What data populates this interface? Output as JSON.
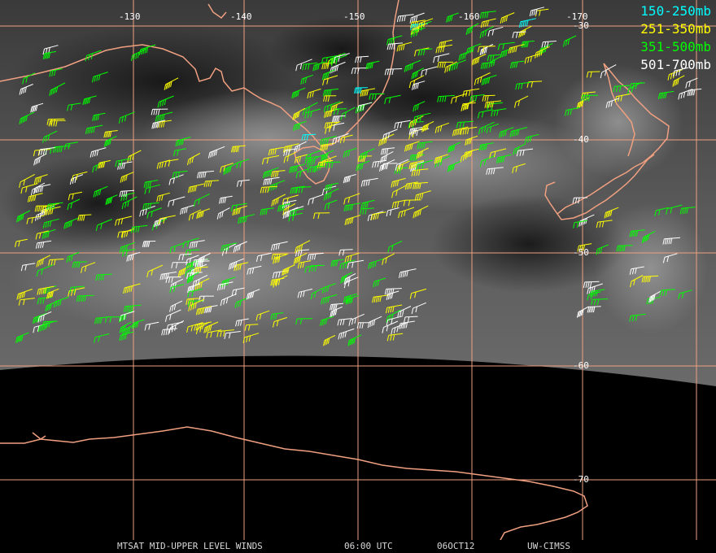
{
  "title_bar": {
    "product": "MTSAT MID-UPPER LEVEL WINDS",
    "time": "06:00 UTC",
    "date": "06OCT12",
    "credit": "UW-CIMSS"
  },
  "legend": [
    {
      "label": "150-250mb",
      "color": "#00ffff"
    },
    {
      "label": "251-350mb",
      "color": "#ffff00"
    },
    {
      "label": "351-500mb",
      "color": "#00ff00"
    },
    {
      "label": "501-700mb",
      "color": "#ffffff"
    }
  ],
  "longitude_labels": [
    "-130",
    "-140",
    "-150",
    "-160",
    "-170"
  ],
  "latitude_labels": [
    "-30",
    "-40",
    "-50",
    "-60",
    "-70"
  ],
  "colors": {
    "grid": "#f0a080",
    "coastline": "#f0a080",
    "space": "#000000"
  }
}
